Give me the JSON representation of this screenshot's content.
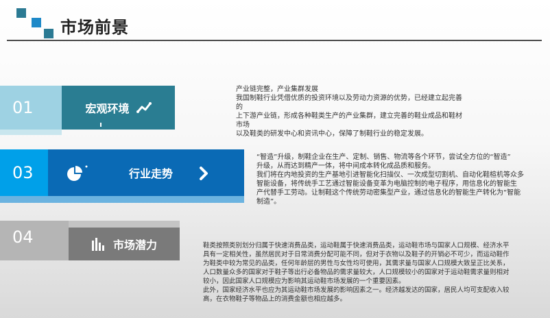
{
  "header": {
    "title": "市场前景"
  },
  "sections": [
    {
      "number": "01",
      "label": "宏观环境",
      "text": [
        "产业链完整，产业集群发展",
        "我国制鞋行业凭借优质的投资环境以及劳动力资源的优势，已经建立起完善的",
        "上下游产业链，形成各种鞋类生产的产业集群，建立完善的鞋业成品和鞋材市场",
        "以及鞋类的研发中心和资讯中心，保障了制鞋行业的稳定发展。"
      ]
    },
    {
      "number": "03",
      "label": "行业走势",
      "text": [
        "“智造”升级，制鞋企业在生产、定制、销售、物流等各个环节，尝试全方位的“智造”",
        "升级，从而达到精产一体，将中间成本转化成品质和服务。",
        "我们将在内地投资的生产基地引进智能化扫描仪、一次成型切割机、自动化鞋楦机等众多",
        "智能设备，将传统手工艺通过智能设备变革为电脑控制的电子程序，用信息化的智能生",
        "产代替手工劳动。让制鞋这个传统劳动密集型产业，通过信息化的智能生产转化为“智能",
        "制造”。"
      ]
    },
    {
      "number": "04",
      "label": "市场潜力",
      "text": [
        "鞋类按照类别划分归属于快速消费品类，运动鞋属于快速消费品类，运动鞋市场与国家人口规模、经济水平",
        "具有一定相关性，虽然居民对于日常消费分配可能不同，但对于衣物以及鞋子的开销必不可少，而运动鞋作",
        "为鞋类中较为常见的品类，任何年龄层的男性与女性均可使用，其需求量与国家人口规模大致呈正比关系，",
        "人口数量众多的国家对于鞋子等出行必备物品的需求量较大，人口规模较小的国家对于运动鞋需求量则相对",
        "较小，因此国家人口规模应为影响其运动鞋市场发展的一个重要因素。",
        "此外，国家经济水平也应为其运动鞋市场发展的影响因素之一。经济越发达的国家，居民人均可支配收入较",
        "高，在衣物鞋子等物品上的消费金额也相应越多。"
      ]
    }
  ],
  "colors": {
    "teal": "#2a7d92",
    "blue": "#0a6ab5",
    "cyan": "#00a0e9",
    "gray": "#7a7a7a"
  }
}
